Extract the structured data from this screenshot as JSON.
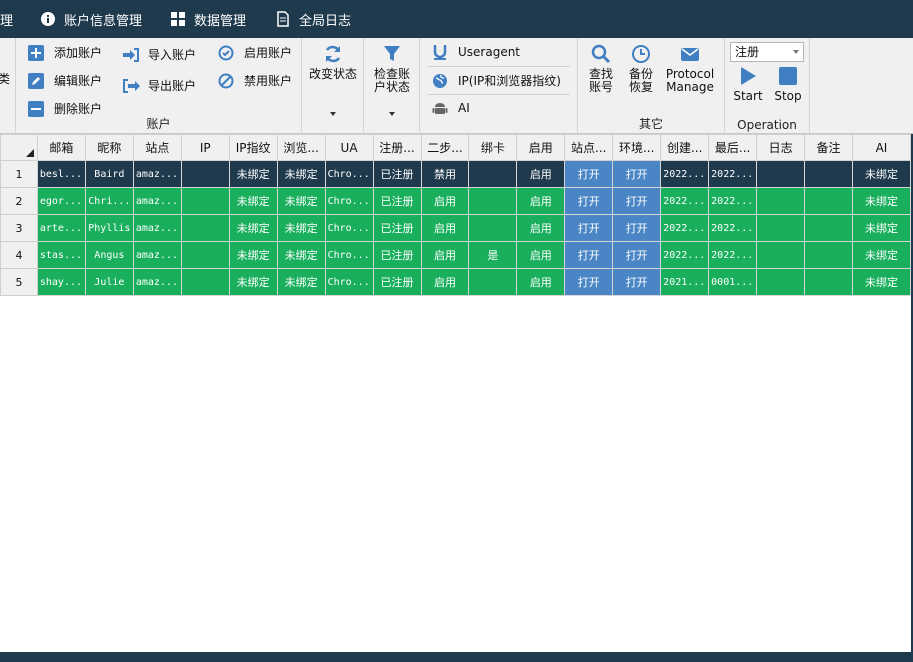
{
  "menu": {
    "items": [
      {
        "label": "理"
      },
      {
        "label": "账户信息管理"
      },
      {
        "label": "数据管理"
      },
      {
        "label": "全局日志"
      }
    ]
  },
  "ribbon": {
    "edge_label": "类",
    "account_group": {
      "label": "账户",
      "add": "添加账户",
      "edit": "编辑账户",
      "delete": "删除账户",
      "import": "导入账户",
      "export": "导出账户",
      "enable": "启用账户",
      "disable": "禁用账户"
    },
    "status_group": {
      "change_status": "改变状态",
      "check_status": "检查账户状态"
    },
    "ua_group": {
      "useragent": "Useragent",
      "ip": "IP(IP和浏览器指纹)",
      "ai": "AI"
    },
    "other_group": {
      "label": "其它",
      "find": "查找账号",
      "backup": "备份恢复",
      "protocol": "Protocol Manage"
    },
    "operation_group": {
      "label": "Operation",
      "combo_value": "注册",
      "start": "Start",
      "stop": "Stop"
    }
  },
  "grid": {
    "columns": [
      "邮箱",
      "昵称",
      "站点",
      "IP",
      "IP指纹",
      "浏览...",
      "UA",
      "注册...",
      "二步...",
      "绑卡",
      "启用",
      "站点...",
      "环境...",
      "创建...",
      "最后...",
      "日志",
      "备注",
      "AI"
    ],
    "rows": [
      {
        "num": "1",
        "cells": [
          "besl...",
          "Baird",
          "amaz...",
          "",
          "未绑定",
          "未绑定",
          "Chro...",
          "已注册",
          "禁用",
          "",
          "启用",
          "打开",
          "打开",
          "2022...",
          "2022...",
          "",
          "",
          "未绑定"
        ]
      },
      {
        "num": "2",
        "cells": [
          "egor...",
          "Chri...",
          "amaz...",
          "",
          "未绑定",
          "未绑定",
          "Chro...",
          "已注册",
          "启用",
          "",
          "启用",
          "打开",
          "打开",
          "2022...",
          "2022...",
          "",
          "",
          "未绑定"
        ]
      },
      {
        "num": "3",
        "cells": [
          "arte...",
          "Phyllis",
          "amaz...",
          "",
          "未绑定",
          "未绑定",
          "Chro...",
          "已注册",
          "启用",
          "",
          "启用",
          "打开",
          "打开",
          "2022...",
          "2022...",
          "",
          "",
          "未绑定"
        ]
      },
      {
        "num": "4",
        "cells": [
          "stas...",
          "Angus",
          "amaz...",
          "",
          "未绑定",
          "未绑定",
          "Chro...",
          "已注册",
          "启用",
          "是",
          "启用",
          "打开",
          "打开",
          "2022...",
          "2022...",
          "",
          "",
          "未绑定"
        ]
      },
      {
        "num": "5",
        "cells": [
          "shay...",
          "Julie",
          "amaz...",
          "",
          "未绑定",
          "未绑定",
          "Chro...",
          "已注册",
          "启用",
          "",
          "启用",
          "打开",
          "打开",
          "2021...",
          "0001...",
          "",
          "",
          "未绑定"
        ]
      }
    ]
  },
  "colors": {
    "accent_dark": "#1f3a4d",
    "row_green": "#1aaf5d",
    "button_blue": "#4a86c5",
    "icon_blue": "#3f7fc2"
  }
}
